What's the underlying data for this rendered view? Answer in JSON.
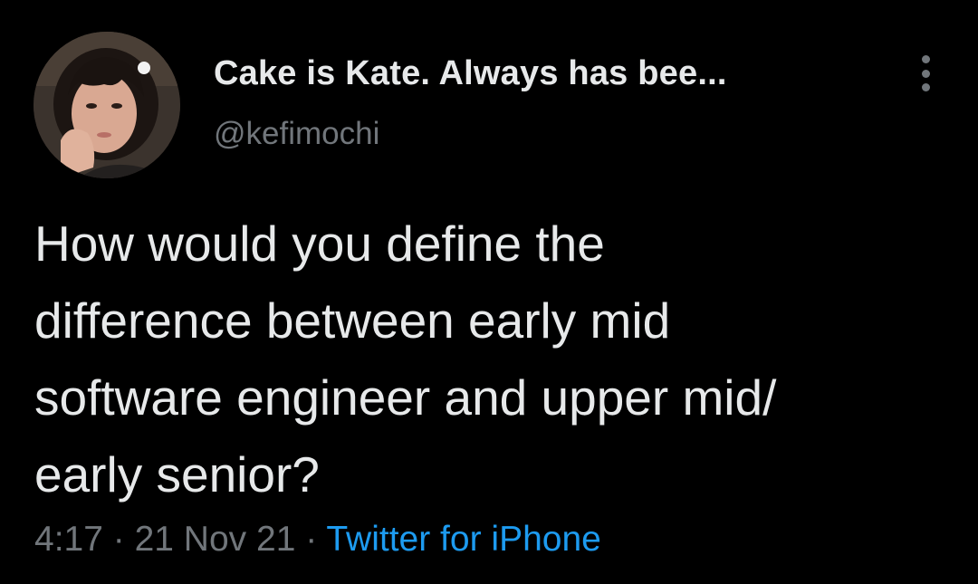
{
  "author": {
    "display_name": "Cake is Kate. Always has bee...",
    "handle": "@kefimochi"
  },
  "tweet": {
    "lines": [
      "How would you define the",
      "difference between early mid",
      "software engineer and upper mid/",
      "early senior?"
    ],
    "time": "4:17",
    "separator": "·",
    "date": "21 Nov 21",
    "source": "Twitter for iPhone"
  },
  "icons": {
    "more": "more-vertical-icon"
  },
  "colors": {
    "background": "#000000",
    "primary_text": "#e7e9ea",
    "secondary_text": "#71767b",
    "link": "#1d9bf0"
  }
}
